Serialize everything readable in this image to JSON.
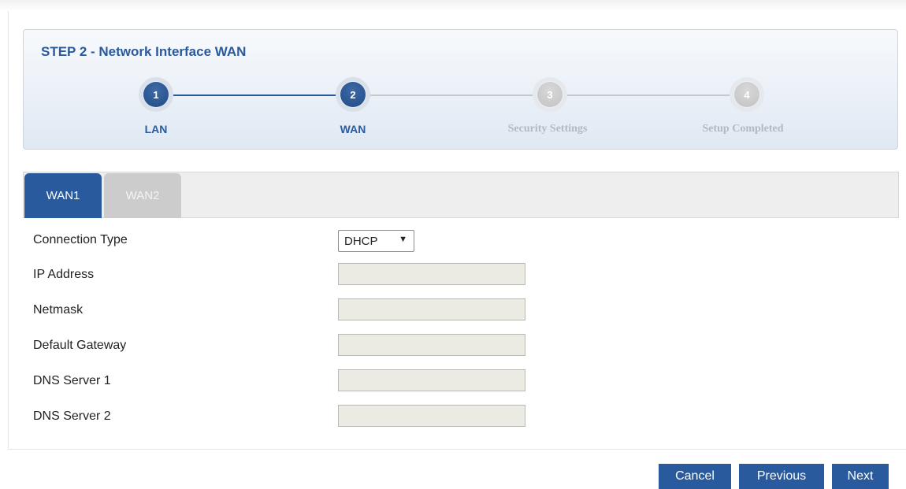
{
  "wizard": {
    "title": "STEP 2 - Network Interface WAN",
    "steps": [
      {
        "number": "1",
        "label": "LAN",
        "state": "done"
      },
      {
        "number": "2",
        "label": "WAN",
        "state": "done"
      },
      {
        "number": "3",
        "label": "Security Settings",
        "state": "todo"
      },
      {
        "number": "4",
        "label": "Setup Completed",
        "state": "todo"
      }
    ],
    "colors": {
      "active": "#2b5a9c",
      "inactive": "#c2c2c2"
    }
  },
  "tabs": [
    {
      "label": "WAN1",
      "active": true
    },
    {
      "label": "WAN2",
      "active": false
    }
  ],
  "form": {
    "connection_type": {
      "label": "Connection Type",
      "value": "DHCP",
      "arrow": "▼"
    },
    "fields": [
      {
        "label": "IP Address",
        "value": ""
      },
      {
        "label": "Netmask",
        "value": ""
      },
      {
        "label": "Default Gateway",
        "value": ""
      },
      {
        "label": "DNS Server 1",
        "value": ""
      },
      {
        "label": "DNS Server 2",
        "value": ""
      }
    ]
  },
  "buttons": {
    "cancel": "Cancel",
    "previous": "Previous",
    "next": "Next"
  }
}
